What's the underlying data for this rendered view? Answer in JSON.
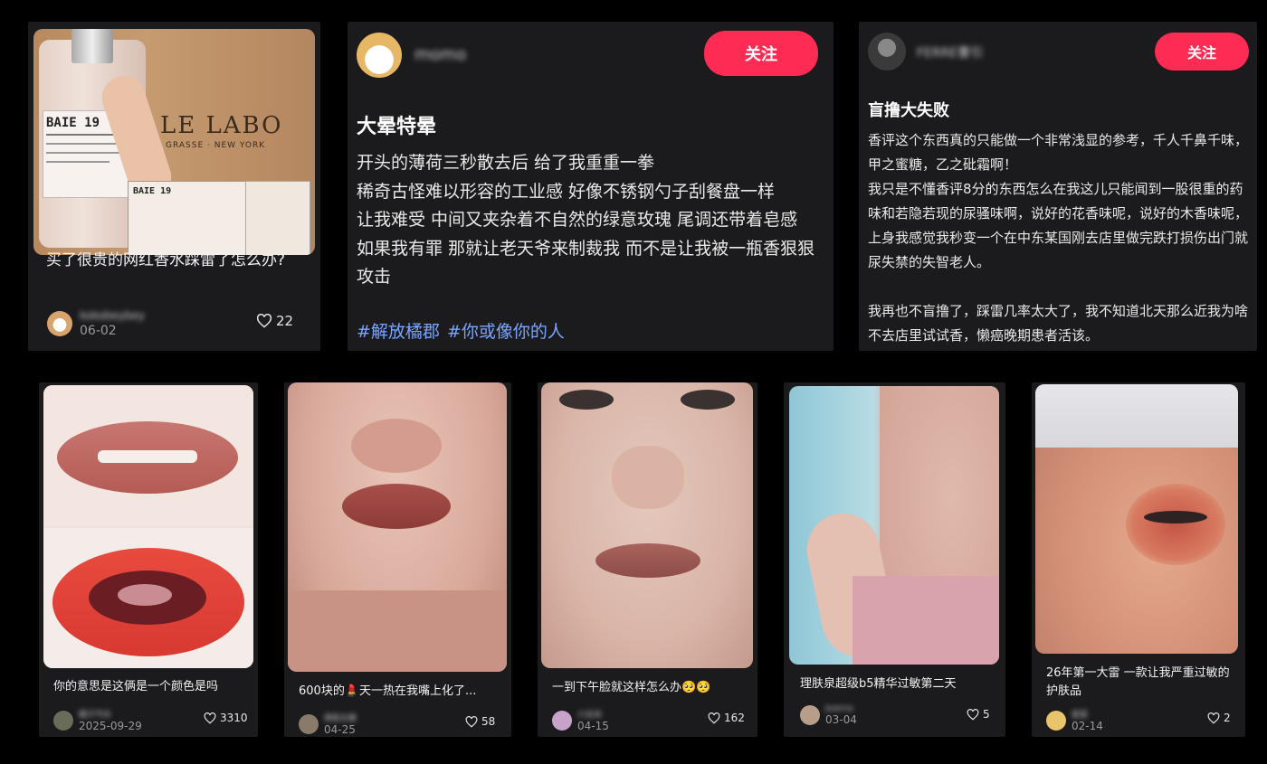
{
  "theme": {
    "background": "#000000",
    "card": "#1b1b1d",
    "accent": "#fe2c55",
    "hashtag": "#7aa5ff"
  },
  "perfume_card": {
    "title": "买了很贵的网红香水踩雷了怎么办?",
    "author": "kokobeybey",
    "date": "06-02",
    "likes": "22",
    "image": {
      "bottle_label": "BAIE 19",
      "box_brand": "LE LABO",
      "box_sub": "GRASSE · NEW YORK"
    }
  },
  "text_card_1": {
    "author": "momo",
    "follow_label": "关注",
    "title": "大晕特晕",
    "body": "开头的薄荷三秒散去后 给了我重重一拳\n稀奇古怪难以形容的工业感 好像不锈钢勺子刮餐盘一样\n让我难受 中间又夹杂着不自然的绿意玫瑰 尾调还带着皂感\n如果我有罪 那就让老天爷来制裁我 而不是让我被一瓶香狠狠攻击",
    "tags": [
      "#解放橘郡",
      "#你或像你的人"
    ]
  },
  "text_card_2": {
    "author": "FERRE曹引",
    "follow_label": "关注",
    "title": "盲撸大失败",
    "body": "香评这个东西真的只能做一个非常浅显的参考，千人千鼻千味，甲之蜜糖，乙之砒霜啊！\n我只是不懂香评8分的东西怎么在我这儿只能闻到一股很重的药味和若隐若现的尿骚味啊，说好的花香味呢，说好的木香味呢，上身我感觉我秒变一个在中东某国刚去店里做完跌打损伤出门就尿失禁的失智老人。\n\n我再也不盲撸了，踩雷几率太大了，我不知道北天那么近我为啥不去店里试试香，懒癌晚期患者活该。"
  },
  "bottom_cards": [
    {
      "title": "你的意思是这俩是一个颜色是吗",
      "author": "橘子汽水",
      "date": "2025-09-29",
      "likes": "3310"
    },
    {
      "title": "600块的💄天一热在我嘴上化了...",
      "author": "南街北巷",
      "date": "04-25",
      "likes": "58"
    },
    {
      "title": "一到下午脸就这样怎么办🥺🥺",
      "author": "小云朵",
      "date": "04-15",
      "likes": "162"
    },
    {
      "title": "理肤泉超级b5精华过敏第二天",
      "author": "Joanna",
      "date": "03-04",
      "likes": "5"
    },
    {
      "title": "26年第一大雷 一款让我严重过敏的护肤品",
      "author": "星星",
      "date": "02-14",
      "likes": "2"
    }
  ]
}
